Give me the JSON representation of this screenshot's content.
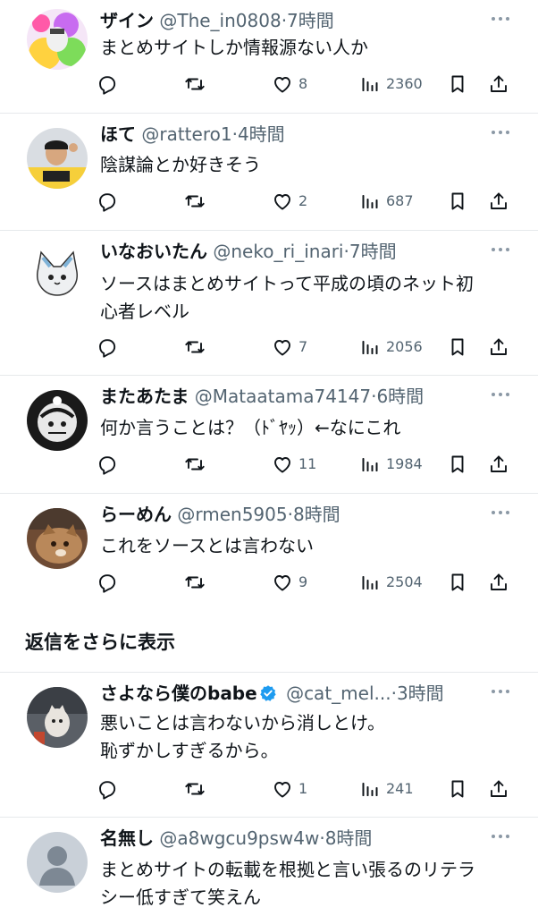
{
  "tweets": [
    {
      "name": "ザイン",
      "handle": "@The_in0808",
      "sep": "·",
      "time": "7時間",
      "lines": [
        "まとめサイトしか情報源ない人か"
      ],
      "likes": "8",
      "views": "2360"
    },
    {
      "name": "ほて",
      "handle": "@rattero1",
      "sep": "·",
      "time": "4時間",
      "lines": [
        "陰謀論とか好きそう"
      ],
      "likes": "2",
      "views": "687"
    },
    {
      "name": "いなおいたん",
      "handle": "@neko_ri_inari",
      "sep": "·",
      "time": "7時間",
      "lines": [
        "ソースはまとめサイトって平成の頃のネット初",
        "心者レベル"
      ],
      "likes": "7",
      "views": "2056"
    },
    {
      "name": "またあたま",
      "handle": "@Mataatama74147",
      "sep": "·",
      "time": "6時間",
      "lines": [
        "何か言うことは？（ﾄﾞﾔｯ）←なにこれ"
      ],
      "likes": "11",
      "views": "1984"
    },
    {
      "name": "らーめん",
      "handle": "@rmen5905",
      "sep": "·",
      "time": "8時間",
      "lines": [
        "これをソースとは言わない"
      ],
      "likes": "9",
      "views": "2504"
    },
    {
      "name": "さよなら僕のbabe",
      "handle": "@cat_mel...",
      "sep": "·",
      "time": "3時間",
      "lines": [
        "悪いことは言わないから消しとけ。",
        "恥ずかしすぎるから。"
      ],
      "likes": "1",
      "views": "241"
    },
    {
      "name": "名無し",
      "handle": "@a8wgcu9psw4w",
      "sep": "·",
      "time": "8時間",
      "lines": [
        "まとめサイトの転載を根拠と言い張るのリテラ",
        "シー低すぎて笑えん"
      ]
    }
  ],
  "more_replies_label": "返信をさらに表示",
  "colors": {
    "text": "#0f1419",
    "secondary": "#536471",
    "divider": "#e6e9eb",
    "verified": "#1d9bf0"
  }
}
